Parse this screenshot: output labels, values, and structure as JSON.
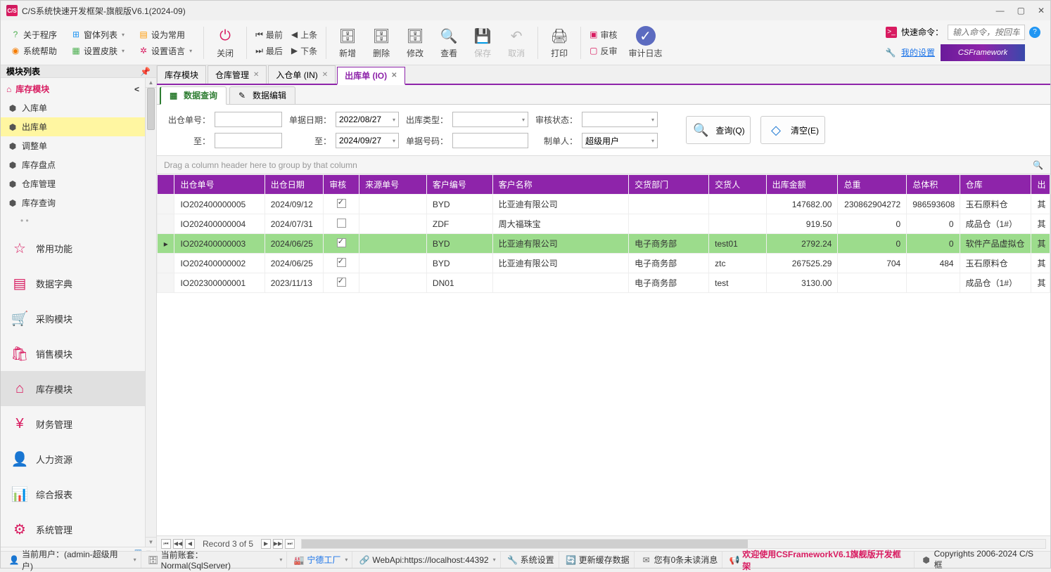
{
  "window": {
    "title": "C/S系统快速开发框架-旗舰版V6.1(2024-09)"
  },
  "toolbar": {
    "leftTop": {
      "about": "关于程序",
      "windows": "窗体列表",
      "setDefault": "设为常用"
    },
    "leftBottom": {
      "help": "系统帮助",
      "skin": "设置皮肤",
      "lang": "设置语言"
    },
    "close": "关闭",
    "navFirst": "最前",
    "navPrev": "上条",
    "navLast": "最后",
    "navNext": "下条",
    "add": "新增",
    "del": "删除",
    "edit": "修改",
    "view": "查看",
    "save": "保存",
    "cancel": "取消",
    "print": "打印",
    "audit": "审核",
    "unaudit": "反审",
    "auditLog": "审计日志",
    "quickCmd": "快速命令：",
    "cmdPlaceholder": "输入命令，按回车",
    "mySettings": "我的设置",
    "brand": "CSFramework"
  },
  "sidebar": {
    "title": "模块列表",
    "rootCat": "库存模块",
    "items": [
      {
        "label": "入库单"
      },
      {
        "label": "出库单"
      },
      {
        "label": "调整单"
      },
      {
        "label": "库存盘点"
      },
      {
        "label": "仓库管理"
      },
      {
        "label": "库存查询"
      }
    ],
    "bigModules": [
      {
        "label": "常用功能"
      },
      {
        "label": "数据字典"
      },
      {
        "label": "采购模块"
      },
      {
        "label": "销售模块"
      },
      {
        "label": "库存模块"
      },
      {
        "label": "财务管理"
      },
      {
        "label": "人力资源"
      },
      {
        "label": "综合报表"
      },
      {
        "label": "系统管理"
      }
    ]
  },
  "tabs": [
    {
      "label": "库存模块",
      "closable": false
    },
    {
      "label": "仓库管理",
      "closable": true
    },
    {
      "label": "入仓单 (IN)",
      "closable": true
    },
    {
      "label": "出库单 (IO)",
      "closable": true,
      "active": true
    }
  ],
  "innerTabs": {
    "query": "数据查询",
    "edit": "数据编辑"
  },
  "form": {
    "outNoLabel": "出仓单号：",
    "toLabel": "至：",
    "dateLabel": "单据日期：",
    "dateFrom": "2022/08/27",
    "dateTo": "2024/09/27",
    "typeLabel": "出库类型：",
    "docNoLabel": "单据号码：",
    "auditLabel": "审核状态：",
    "creatorLabel": "制单人：",
    "creator": "超级用户",
    "searchBtn": "查询(Q)",
    "clearBtn": "清空(E)"
  },
  "grid": {
    "groupHint": "Drag a column header here to group by that column",
    "headers": {
      "outNo": "出仓单号",
      "outDate": "出仓日期",
      "audit": "审核",
      "srcNo": "来源单号",
      "custCode": "客户编号",
      "custName": "客户名称",
      "dept": "交货部门",
      "deliverer": "交货人",
      "amount": "出库金额",
      "weight": "总重",
      "volume": "总体积",
      "warehouse": "仓库",
      "last": "出"
    },
    "rows": [
      {
        "no": "IO202400000005",
        "date": "2024/09/12",
        "audit": true,
        "src": "",
        "ccode": "BYD",
        "cname": "比亚迪有限公司",
        "dept": "",
        "dlv": "",
        "amt": "147682.00",
        "wt": "230862904272",
        "vol": "986593608",
        "wh": "玉石原料仓",
        "last": "其"
      },
      {
        "no": "IO202400000004",
        "date": "2024/07/31",
        "audit": false,
        "src": "",
        "ccode": "ZDF",
        "cname": "周大福珠宝",
        "dept": "",
        "dlv": "",
        "amt": "919.50",
        "wt": "0",
        "vol": "0",
        "wh": "成品仓（1#）",
        "last": "其"
      },
      {
        "no": "IO202400000003",
        "date": "2024/06/25",
        "audit": true,
        "src": "",
        "ccode": "BYD",
        "cname": "比亚迪有限公司",
        "dept": "电子商务部",
        "dlv": "test01",
        "amt": "2792.24",
        "wt": "0",
        "vol": "0",
        "wh": "软件产品虚拟仓",
        "last": "其",
        "focused": true
      },
      {
        "no": "IO202400000002",
        "date": "2024/06/25",
        "audit": true,
        "src": "",
        "ccode": "BYD",
        "cname": "比亚迪有限公司",
        "dept": "电子商务部",
        "dlv": "ztc",
        "amt": "267525.29",
        "wt": "704",
        "vol": "484",
        "wh": "玉石原料仓",
        "last": "其"
      },
      {
        "no": "IO202300000001",
        "date": "2023/11/13",
        "audit": true,
        "src": "",
        "ccode": "DN01",
        "cname": "",
        "dept": "电子商务部",
        "dlv": "test",
        "amt": "3130.00",
        "wt": "",
        "vol": "",
        "wh": "成品仓（1#）",
        "last": "其"
      }
    ],
    "navRecord": "Record 3 of 5"
  },
  "statusBar": {
    "user": "当前用户：(admin-超级用户)",
    "acct": "当前账套： Normal(SqlServer)",
    "factory": "宁德工厂",
    "webapi": "WebApi:https://localhost:44392",
    "sysSettings": "系统设置",
    "refresh": "更新缓存数据",
    "unread": "您有0条未读消息",
    "welcome": "欢迎使用CSFrameworkV6.1旗舰版开发框架",
    "copyright": "Copyrights 2006-2024 C/S框"
  }
}
